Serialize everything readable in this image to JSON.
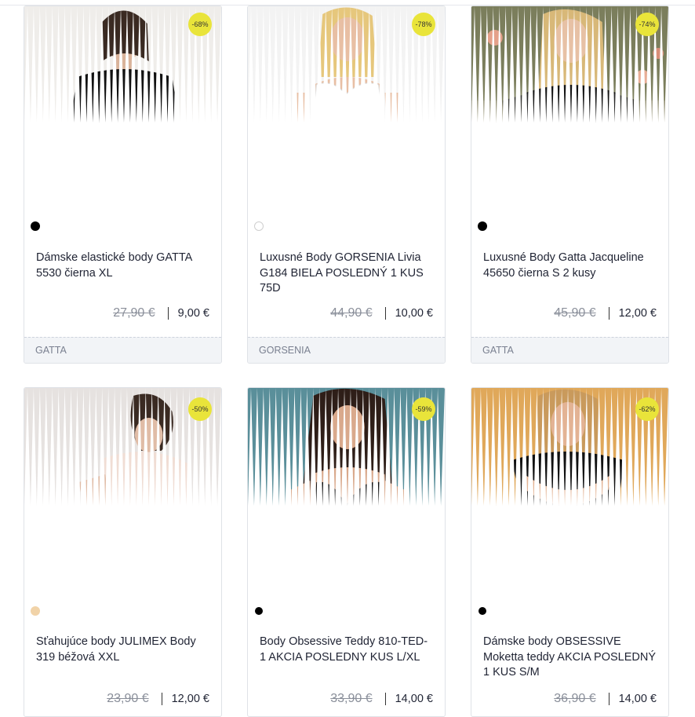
{
  "products": [
    {
      "title": "Dámske elastické body GATTA 5530 čierna XL",
      "old_price": "27,90 €",
      "price": "9,00 €",
      "discount": "-68%",
      "brand": "GATTA",
      "swatch_color": "#000000"
    },
    {
      "title": "Luxusné Body GORSENIA Livia G184 BIELA POSLEDNÝ 1 KUS 75D",
      "old_price": "44,90 €",
      "price": "10,00 €",
      "discount": "-78%",
      "brand": "GORSENIA",
      "swatch_color": "#ffffff"
    },
    {
      "title": "Luxusné Body Gatta Jacqueline 45650 čierna S 2 kusy",
      "old_price": "45,90 €",
      "price": "12,00 €",
      "discount": "-74%",
      "brand": "GATTA",
      "swatch_color": "#000000"
    },
    {
      "title": "Sťahujúce body JULIMEX Body 319 béžová XXL",
      "old_price": "23,90 €",
      "price": "12,00 €",
      "discount": "-50%",
      "brand": "",
      "swatch_color": "#f1d3a8"
    },
    {
      "title": "Body Obsessive Teddy 810-TED-1 AKCIA POSLEDNY KUS L/XL",
      "old_price": "33,90 €",
      "price": "14,00 €",
      "discount": "-59%",
      "brand": "",
      "swatch_color": "#000000"
    },
    {
      "title": "Dámske body OBSESSIVE Moketta teddy AKCIA POSLEDNÝ 1 KUS S/M",
      "old_price": "36,90 €",
      "price": "14,00 €",
      "discount": "-62%",
      "brand": "",
      "swatch_color": "#000000"
    }
  ],
  "colors": {
    "badge": "#e9e43a",
    "brand_bar": "#f2f4f7",
    "old_price": "#8a8f9a"
  }
}
